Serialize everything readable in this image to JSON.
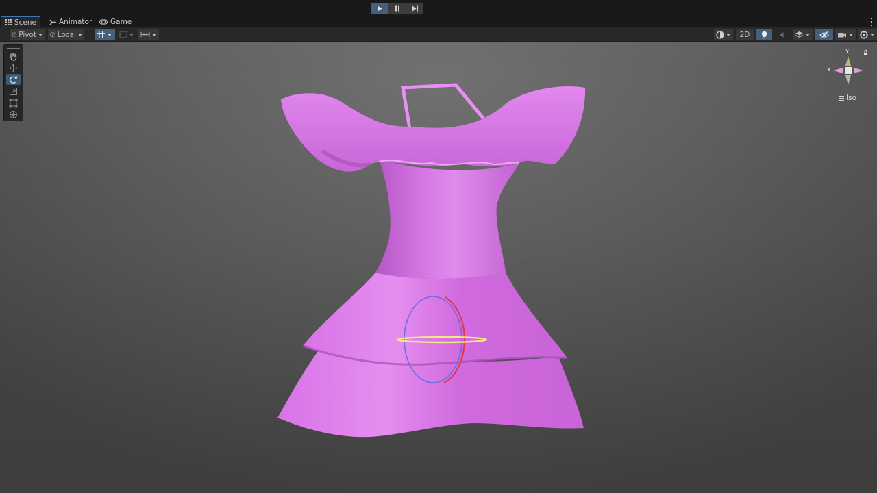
{
  "playbar": {
    "buttons": [
      {
        "name": "play",
        "icon": "play-icon",
        "active": true
      },
      {
        "name": "pause",
        "icon": "pause-icon",
        "active": false
      },
      {
        "name": "step",
        "icon": "step-icon",
        "active": false
      }
    ]
  },
  "tabs": [
    {
      "label": "Scene",
      "icon": "scene-grid-icon",
      "active": true
    },
    {
      "label": "Animator",
      "icon": "animator-icon",
      "active": false
    },
    {
      "label": "Game",
      "icon": "gamepad-icon",
      "active": false
    }
  ],
  "toolbar": {
    "pivot_label": "Pivot",
    "local_label": "Local",
    "two_d_label": "2D"
  },
  "tools": [
    "hand-icon",
    "move-icon",
    "rotate-icon",
    "scale-icon",
    "rect-icon",
    "transform-icon"
  ],
  "gizmo": {
    "x_label": "x",
    "y_label": "y",
    "projection_label": "Iso"
  },
  "colors": {
    "accent": "#46607c",
    "dress": "#d873e6",
    "viewport": "#5c5c5c"
  }
}
